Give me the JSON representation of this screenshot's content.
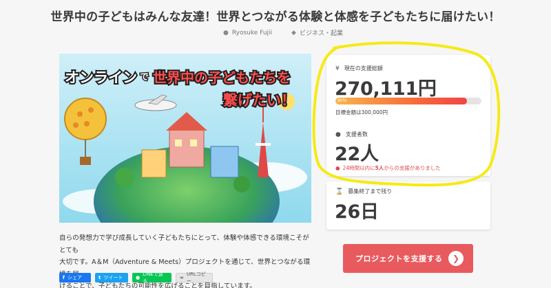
{
  "page": {
    "title": "世界中の子どもはみんな友達！世界とつながる体験と体感を子どもたちに届けたい！"
  },
  "meta": {
    "author": "Ryosuke Fujii",
    "category": "ビジネス・起業"
  },
  "hero": {
    "line1_a": "オンライン",
    "line1_b": "で",
    "line1_c": "世界中の子どもたちを",
    "line2": "繋げたい！"
  },
  "description": {
    "line1": "自らの発想力で学び成長していく子どもたちにとって、体験や体感できる環境こそがとても",
    "line2": "大切です。A＆M（Adventure & Meets）プロジェクトを通じて、世界とつながる環境を届",
    "line3": "けることで、子どもたちの可能性を広げることを目指しています。"
  },
  "share": {
    "facebook": "シェア",
    "twitter": "ツイート",
    "line": "LINEで送る",
    "url": "URLコピー"
  },
  "stats": {
    "amount_label": "現在の支援総額",
    "amount": "270,111円",
    "progress_percent": 90,
    "progress_label": "90%",
    "goal": "目標金額は300,000円",
    "supporters_label": "支援者数",
    "supporters": "22人",
    "recent_prefix": "24時間以内に",
    "recent_count": "5人",
    "recent_suffix": "からの支援がありました",
    "remaining_label": "募集終了まで残り",
    "remaining": "26日"
  },
  "cta": {
    "label": "プロジェクトを支援する"
  },
  "icons": {
    "author": "user-icon",
    "category": "tag-icon",
    "amount": "yen-icon",
    "supporters": "person-icon",
    "recent": "people-icon",
    "remaining": "hourglass-icon",
    "cta": "chevron-right-icon"
  },
  "colors": {
    "accent": "#e85a5e",
    "progress_start": "#f7b54c",
    "progress_end": "#f04545",
    "highlight": "#f5ea14"
  }
}
